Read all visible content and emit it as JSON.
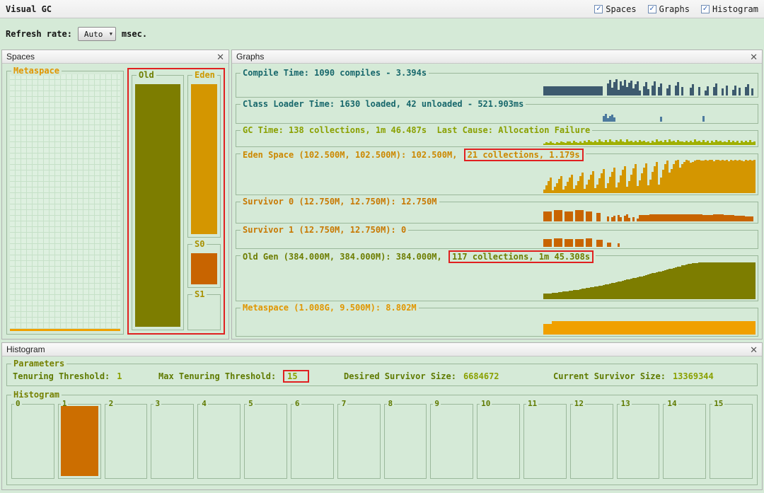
{
  "colors": {
    "background": "#d5ead7",
    "annotation_red": "#e02020",
    "metaspace_label": "#e09600",
    "metaspace_used": "#f0a000",
    "old_label": "#6d7d00",
    "old_fill": "#7d7d00",
    "eden_label": "#cc9900",
    "eden_fill": "#d49600",
    "s_label": "#a89000",
    "s0_fill": "#c86400",
    "param_label": "#5f7a00",
    "param_value": "#8aa000",
    "group_title": "#758000",
    "bin_label": "#5f7a00",
    "bin_fill": "#cc6e00"
  },
  "titlebar": {
    "title": "Visual GC",
    "checkboxes": [
      {
        "label": "Spaces",
        "checked": true
      },
      {
        "label": "Graphs",
        "checked": true
      },
      {
        "label": "Histogram",
        "checked": true
      }
    ]
  },
  "toolbar": {
    "refresh_label": "Refresh rate:",
    "refresh_value": "Auto",
    "refresh_unit": "msec."
  },
  "spaces": {
    "title": "Spaces",
    "metaspace_label": "Metaspace",
    "old_label": "Old",
    "eden_label": "Eden",
    "s0_label": "S0",
    "s1_label": "S1"
  },
  "graphs": {
    "title": "Graphs",
    "rows": [
      {
        "label": "Compile Time: 1090 compiles - 3.394s",
        "boxed": "",
        "label_color": "#17676b",
        "color": "#3d5a6e",
        "values": [
          55,
          55,
          55,
          55,
          55,
          55,
          55,
          55,
          55,
          55,
          55,
          55,
          55,
          55,
          55,
          55,
          55,
          55,
          55,
          55,
          55,
          55,
          55,
          55,
          55,
          55,
          55,
          55,
          0,
          0,
          70,
          90,
          45,
          80,
          95,
          35,
          85,
          60,
          90,
          50,
          75,
          88,
          40,
          65,
          82,
          30,
          0,
          55,
          78,
          36,
          0,
          60,
          85,
          0,
          48,
          70,
          0,
          0,
          40,
          62,
          0,
          0,
          58,
          80,
          0,
          52,
          0,
          0,
          0,
          45,
          68,
          0,
          0,
          50,
          0,
          0,
          30,
          55,
          0,
          0,
          48,
          70,
          0,
          0,
          42,
          0,
          60,
          0,
          0,
          35,
          58,
          0,
          44,
          0,
          0,
          52,
          66,
          0,
          40,
          0
        ]
      },
      {
        "label": "Class Loader Time: 1630 loaded, 42 unloaded - 521.903ms",
        "boxed": "",
        "label_color": "#17676b",
        "color": "#4d7a9e",
        "values": [
          0,
          0,
          0,
          0,
          0,
          0,
          0,
          0,
          0,
          0,
          0,
          0,
          0,
          0,
          0,
          0,
          0,
          0,
          0,
          0,
          0,
          0,
          0,
          0,
          0,
          0,
          0,
          0,
          45,
          65,
          30,
          50,
          58,
          38,
          0,
          0,
          0,
          0,
          0,
          0,
          0,
          0,
          0,
          0,
          0,
          0,
          0,
          0,
          0,
          0,
          0,
          0,
          0,
          0,
          0,
          40,
          0,
          0,
          0,
          0,
          0,
          0,
          0,
          0,
          0,
          0,
          0,
          0,
          0,
          0,
          0,
          0,
          0,
          0,
          0,
          48,
          0,
          0,
          0,
          0,
          0,
          0,
          0,
          0,
          0,
          0,
          0,
          0,
          0,
          0,
          0,
          0,
          0,
          0,
          0,
          0,
          0,
          0,
          0,
          0
        ]
      },
      {
        "label": "GC Time: 138 collections, 1m 46.487s  Last Cause: Allocation Failure",
        "boxed": "",
        "label_color": "#8aa000",
        "color": "#a0b000",
        "values": [
          15,
          30,
          20,
          35,
          25,
          18,
          32,
          22,
          40,
          28,
          20,
          35,
          35,
          25,
          45,
          30,
          22,
          38,
          26,
          48,
          30,
          55,
          35,
          28,
          50,
          32,
          60,
          38,
          30,
          52,
          34,
          62,
          40,
          32,
          55,
          36,
          65,
          42,
          34,
          58,
          36,
          50,
          30,
          45,
          28,
          55,
          35,
          48,
          30,
          42,
          26,
          50,
          32,
          58,
          36,
          45,
          28,
          52,
          34,
          60,
          38,
          48,
          30,
          55,
          35,
          42,
          28,
          50,
          32,
          45,
          30,
          58,
          36,
          48,
          28,
          52,
          34,
          44,
          26,
          50,
          32,
          55,
          35,
          46,
          28,
          42,
          30,
          52,
          34,
          48,
          30,
          44,
          26,
          50,
          32,
          46,
          28,
          54,
          34,
          40
        ]
      },
      {
        "label": "Eden Space (102.500M, 102.500M): 102.500M, ",
        "boxed": "21 collections, 1.179s",
        "label_color": "#cc8800",
        "color": "#d49600",
        "values": [
          10,
          22,
          35,
          45,
          8,
          18,
          30,
          42,
          50,
          10,
          20,
          34,
          46,
          55,
          12,
          22,
          36,
          50,
          60,
          12,
          24,
          40,
          54,
          65,
          14,
          26,
          44,
          58,
          70,
          15,
          30,
          48,
          62,
          75,
          16,
          32,
          52,
          68,
          80,
          18,
          35,
          55,
          72,
          85,
          20,
          38,
          58,
          76,
          88,
          22,
          40,
          62,
          80,
          92,
          24,
          45,
          68,
          85,
          95,
          60,
          70,
          85,
          95,
          98,
          75,
          85,
          92,
          98,
          95,
          90,
          92,
          96,
          98,
          97,
          95,
          96,
          98,
          95,
          97,
          98,
          94,
          97,
          98,
          96,
          98,
          95,
          97,
          94,
          98,
          96,
          97,
          95,
          98,
          96,
          94,
          98,
          96,
          97,
          95,
          98
        ]
      },
      {
        "label": "Survivor 0 (12.750M, 12.750M): 12.750M",
        "boxed": "",
        "label_color": "#c87800",
        "color": "#c86400",
        "values": [
          72,
          72,
          72,
          72,
          0,
          78,
          78,
          78,
          78,
          0,
          70,
          70,
          70,
          70,
          0,
          80,
          80,
          80,
          80,
          0,
          72,
          72,
          72,
          0,
          0,
          60,
          60,
          0,
          0,
          0,
          35,
          0,
          28,
          40,
          0,
          45,
          30,
          0,
          38,
          48,
          25,
          0,
          30,
          0,
          20,
          45,
          45,
          45,
          45,
          45,
          48,
          48,
          48,
          48,
          48,
          50,
          50,
          50,
          50,
          50,
          48,
          48,
          48,
          48,
          48,
          52,
          52,
          52,
          52,
          52,
          50,
          50,
          50,
          50,
          50,
          46,
          46,
          46,
          46,
          46,
          48,
          48,
          48,
          48,
          48,
          44,
          44,
          44,
          44,
          44,
          40,
          40,
          40,
          40,
          40,
          36,
          36,
          36,
          36,
          0
        ]
      },
      {
        "label": "Survivor 1 (12.750M, 12.750M): 0",
        "boxed": "",
        "label_color": "#c87800",
        "color": "#c86400",
        "values": [
          70,
          70,
          70,
          70,
          0,
          74,
          74,
          74,
          74,
          0,
          70,
          70,
          70,
          70,
          0,
          68,
          68,
          68,
          68,
          0,
          72,
          72,
          72,
          0,
          0,
          65,
          65,
          65,
          0,
          0,
          40,
          40,
          0,
          0,
          0,
          30,
          0,
          0,
          0,
          0,
          0,
          0,
          0,
          0,
          0,
          0,
          0,
          0,
          0,
          0,
          0,
          0,
          0,
          0,
          0,
          0,
          0,
          0,
          0,
          0,
          0,
          0,
          0,
          0,
          0,
          0,
          0,
          0,
          0,
          0,
          0,
          0,
          0,
          0,
          0,
          0,
          0,
          0,
          0,
          0,
          0,
          0,
          0,
          0,
          0,
          0,
          0,
          0,
          0,
          0,
          0,
          0,
          0,
          0,
          0,
          0,
          0,
          0,
          0,
          0
        ]
      },
      {
        "label": "Old Gen (384.000M, 384.000M): 384.000M, ",
        "boxed": "117 collections, 1m 45.308s",
        "label_color": "#6d7d00",
        "color": "#7d7d00",
        "values": [
          14,
          14,
          15,
          15,
          16,
          17,
          17,
          18,
          19,
          20,
          20,
          21,
          22,
          23,
          24,
          24,
          25,
          26,
          27,
          28,
          29,
          30,
          31,
          32,
          33,
          34,
          35,
          36,
          37,
          38,
          39,
          40,
          42,
          43,
          44,
          46,
          47,
          48,
          50,
          51,
          52,
          54,
          55,
          56,
          58,
          59,
          60,
          62,
          63,
          65,
          66,
          68,
          69,
          70,
          72,
          73,
          75,
          76,
          78,
          79,
          80,
          82,
          83,
          85,
          86,
          88,
          89,
          90,
          92,
          93,
          94,
          95,
          95,
          96,
          96,
          96,
          96,
          96,
          96,
          96,
          96,
          96,
          96,
          96,
          96,
          96,
          96,
          96,
          96,
          96,
          96,
          96,
          96,
          96,
          96,
          96,
          96,
          96,
          96,
          96
        ]
      },
      {
        "label": "Metaspace (1.008G, 9.500M): 8.802M",
        "boxed": "",
        "label_color": "#e09600",
        "color": "#f0a000",
        "values": [
          50,
          50,
          50,
          50,
          62,
          62,
          62,
          62,
          62,
          62,
          62,
          62,
          62,
          62,
          62,
          62,
          62,
          62,
          62,
          62,
          62,
          62,
          62,
          62,
          62,
          62,
          62,
          62,
          62,
          62,
          62,
          62,
          62,
          62,
          62,
          62,
          62,
          62,
          62,
          62,
          62,
          62,
          62,
          62,
          62,
          62,
          62,
          62,
          62,
          62,
          62,
          62,
          62,
          62,
          62,
          62,
          62,
          62,
          62,
          62,
          62,
          62,
          62,
          62,
          62,
          62,
          62,
          62,
          62,
          62,
          62,
          62,
          62,
          62,
          62,
          62,
          62,
          62,
          62,
          62,
          62,
          62,
          62,
          62,
          62,
          62,
          62,
          62,
          62,
          62,
          62,
          62,
          62,
          62,
          62,
          62,
          62,
          62,
          62,
          62
        ]
      }
    ]
  },
  "histogram": {
    "title": "Histogram",
    "parameters": {
      "title": "Parameters",
      "items": [
        {
          "label": "Tenuring Threshold:",
          "value": "1"
        },
        {
          "label": "Max Tenuring Threshold:",
          "value": "15"
        },
        {
          "label": "Desired Survivor Size:",
          "value": "6684672"
        },
        {
          "label": "Current Survivor Size:",
          "value": "13369344"
        }
      ]
    },
    "bins_title": "Histogram",
    "bins": [
      {
        "label": "0",
        "fill": 0
      },
      {
        "label": "1",
        "fill": 95
      },
      {
        "label": "2",
        "fill": 0
      },
      {
        "label": "3",
        "fill": 0
      },
      {
        "label": "4",
        "fill": 0
      },
      {
        "label": "5",
        "fill": 0
      },
      {
        "label": "6",
        "fill": 0
      },
      {
        "label": "7",
        "fill": 0
      },
      {
        "label": "8",
        "fill": 0
      },
      {
        "label": "9",
        "fill": 0
      },
      {
        "label": "10",
        "fill": 0
      },
      {
        "label": "11",
        "fill": 0
      },
      {
        "label": "12",
        "fill": 0
      },
      {
        "label": "13",
        "fill": 0
      },
      {
        "label": "14",
        "fill": 0
      },
      {
        "label": "15",
        "fill": 0
      }
    ]
  }
}
